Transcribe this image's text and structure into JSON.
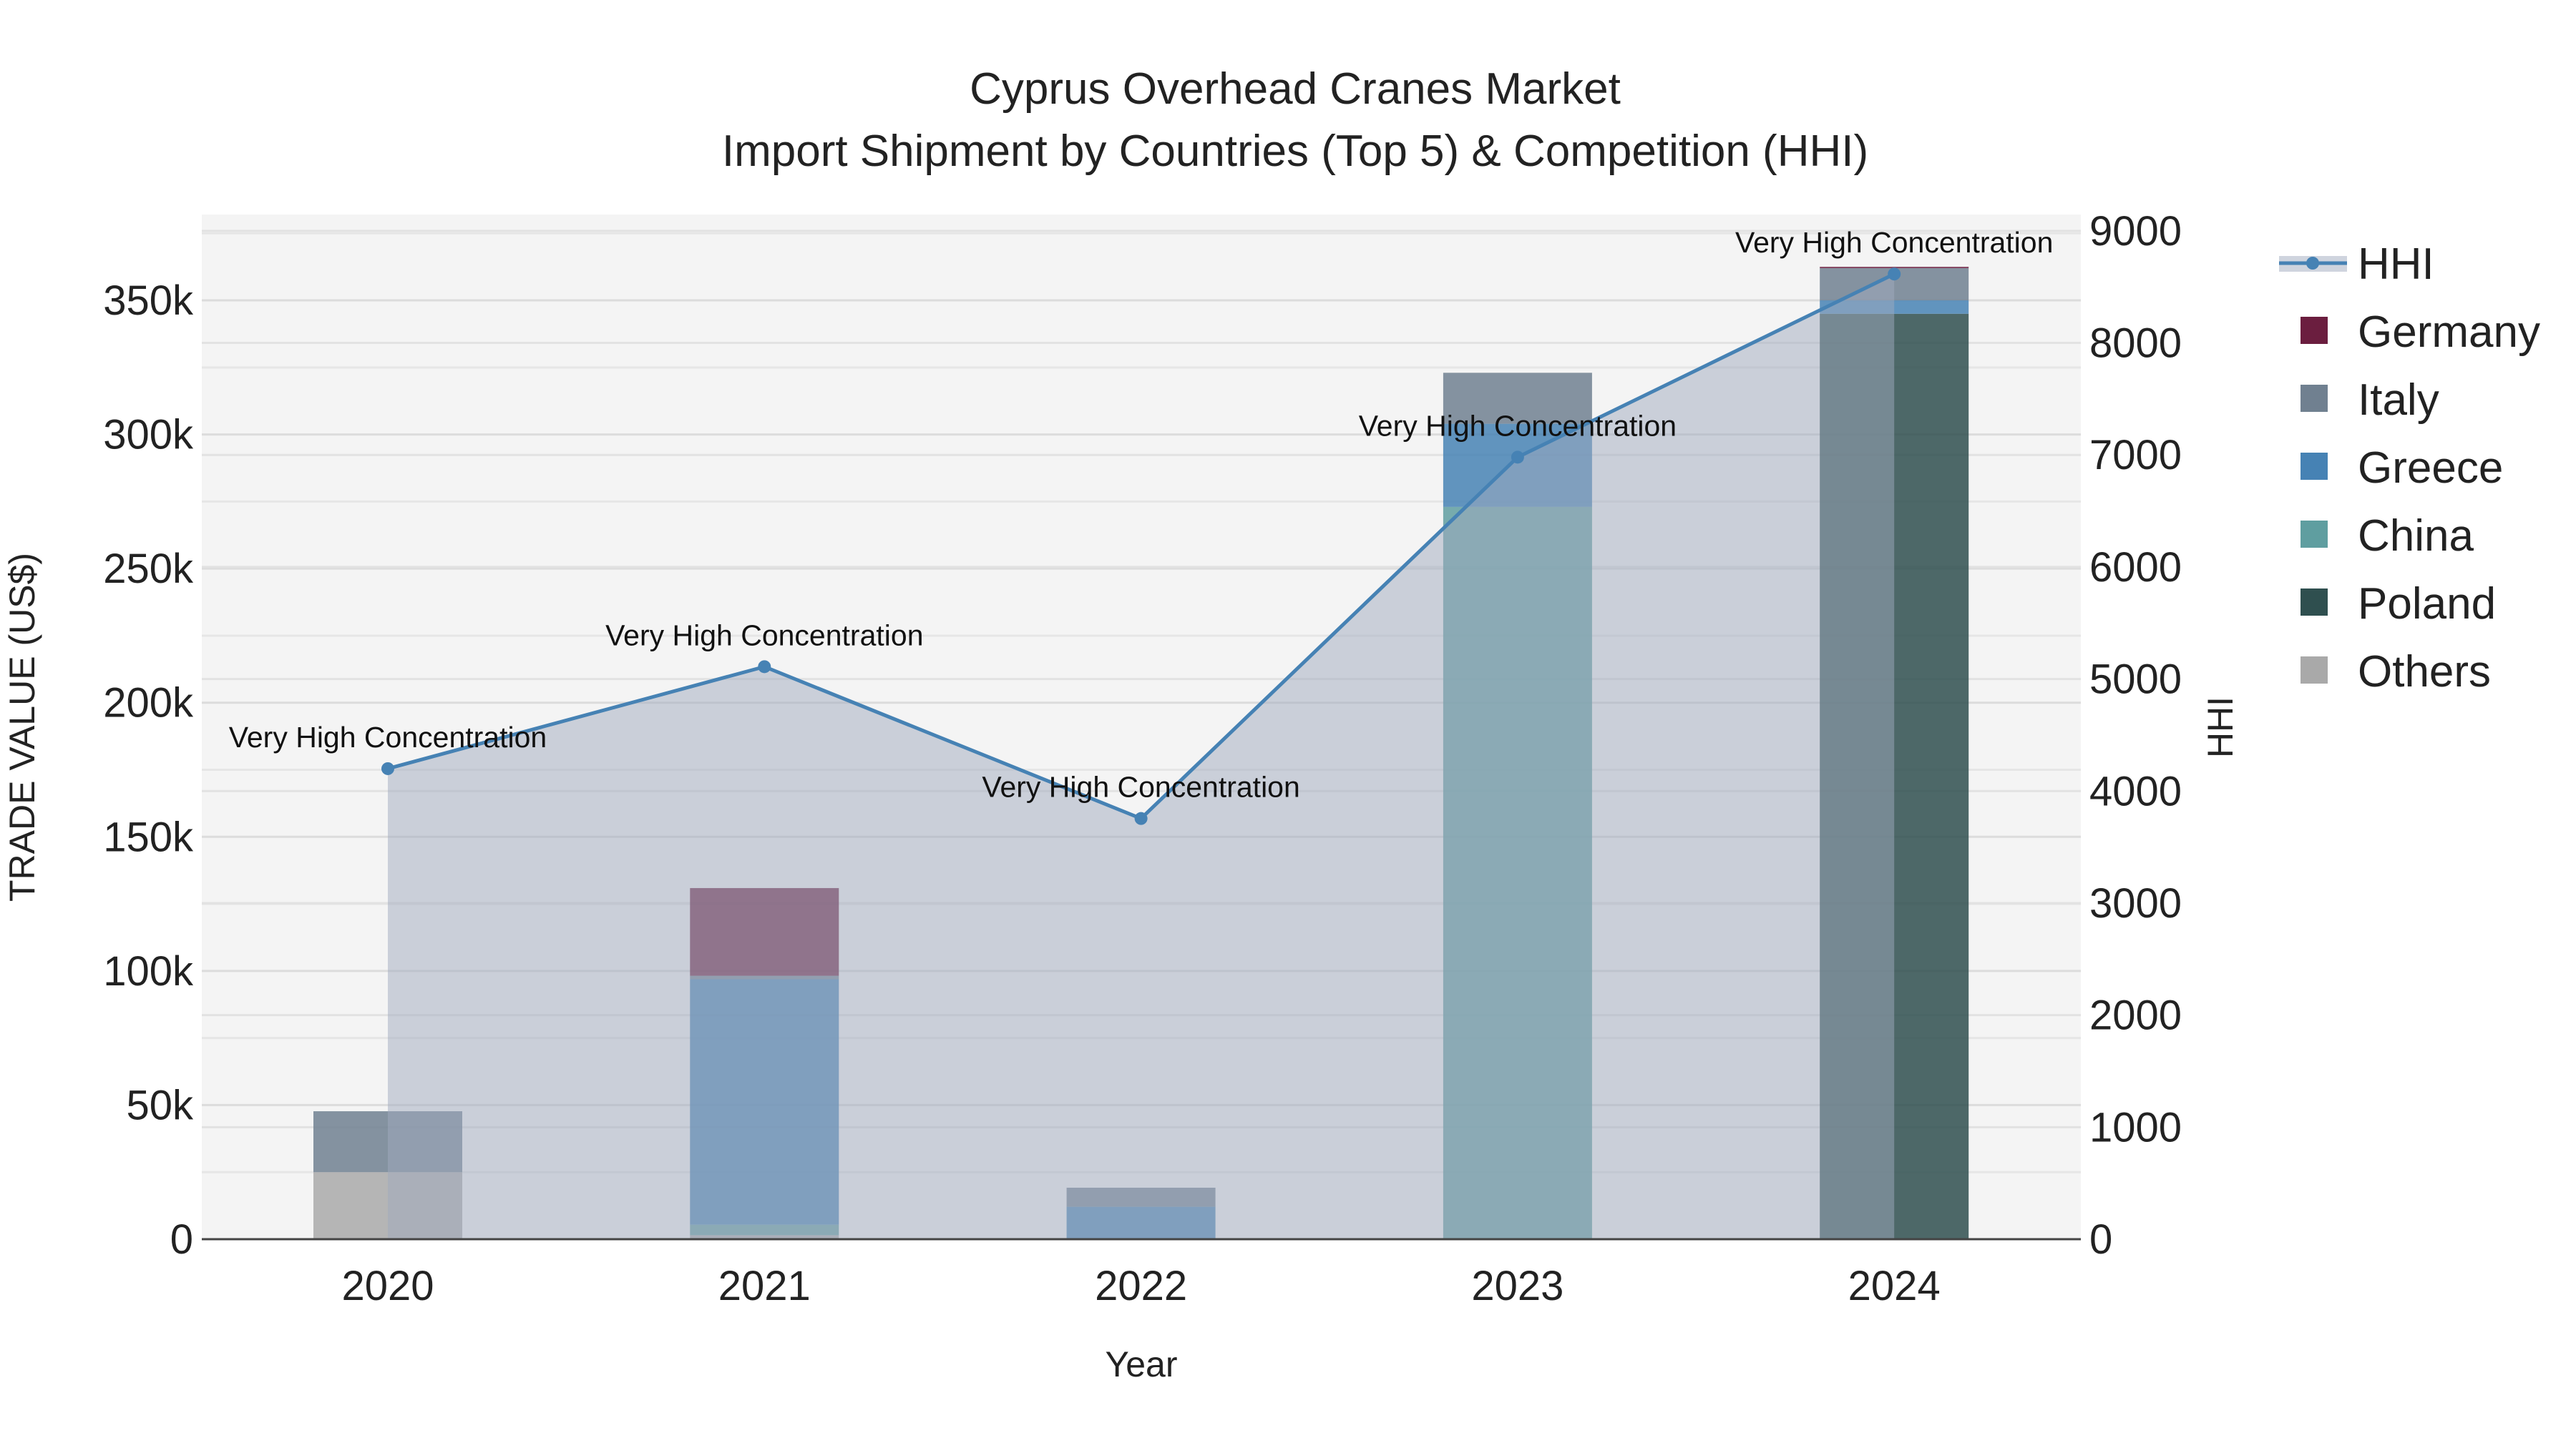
{
  "chart_data": {
    "type": "bar",
    "title": "Cyprus Overhead Cranes Market",
    "subtitle": "Import Shipment by Countries (Top 5) & Competition (HHI)",
    "xlabel": "Year",
    "ylabel": "TRADE VALUE (US$)",
    "y2label": "HHI",
    "categories": [
      "2020",
      "2021",
      "2022",
      "2023",
      "2024"
    ],
    "ylim": [
      0,
      382000
    ],
    "y2lim": [
      0,
      9146
    ],
    "yticks": [
      0,
      50000,
      100000,
      150000,
      200000,
      250000,
      300000,
      350000
    ],
    "ytick_labels": [
      "0",
      "50k",
      "100k",
      "150k",
      "200k",
      "250k",
      "300k",
      "350k"
    ],
    "y2ticks": [
      0,
      1000,
      2000,
      3000,
      4000,
      5000,
      6000,
      7000,
      8000,
      9000
    ],
    "y2tick_labels": [
      "0",
      "1000",
      "2000",
      "3000",
      "4000",
      "5000",
      "6000",
      "7000",
      "8000",
      "9000"
    ],
    "stacked_series_bottom_to_top": [
      {
        "name": "Others",
        "color": "#a9a9a9",
        "values": [
          25000,
          1500,
          0,
          0,
          0
        ]
      },
      {
        "name": "Poland",
        "color": "#2f4f4f",
        "values": [
          0,
          0,
          0,
          0,
          345000
        ]
      },
      {
        "name": "China",
        "color": "#5f9ea0",
        "values": [
          0,
          3900,
          0,
          273000,
          0
        ]
      },
      {
        "name": "Greece",
        "color": "#4682b4",
        "values": [
          0,
          91500,
          12100,
          31000,
          5000
        ]
      },
      {
        "name": "Italy",
        "color": "#708090",
        "values": [
          22700,
          1300,
          7100,
          19000,
          12000
        ]
      },
      {
        "name": "Germany",
        "color": "#6b1e3f",
        "values": [
          0,
          32700,
          0,
          0,
          500
        ]
      }
    ],
    "hhi": {
      "name": "HHI",
      "color": "#4682b4",
      "values": [
        4200,
        5110,
        3755,
        6980,
        8615
      ]
    },
    "annotations": [
      "Very High Concentration",
      "Very High Concentration",
      "Very High Concentration",
      "Very High Concentration",
      "Very High Concentration"
    ],
    "legend": [
      "HHI",
      "Germany",
      "Italy",
      "Greece",
      "China",
      "Poland",
      "Others"
    ],
    "legend_placement": "right",
    "grid": true
  }
}
